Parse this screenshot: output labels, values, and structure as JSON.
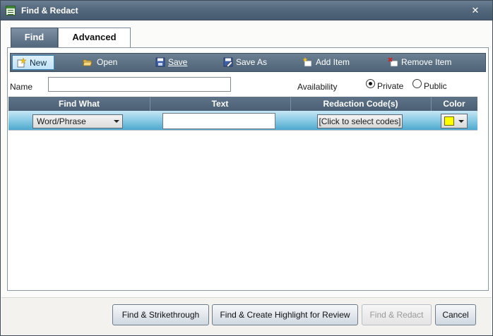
{
  "window": {
    "title": "Find & Redact",
    "close_glyph": "✕"
  },
  "tabs": [
    {
      "label": "Find",
      "active": false
    },
    {
      "label": "Advanced",
      "active": true
    }
  ],
  "toolbar": {
    "items": [
      {
        "label": "New",
        "icon": "new-document-icon"
      },
      {
        "label": "Open",
        "icon": "folder-open-icon"
      },
      {
        "label": "Save",
        "icon": "save-disk-icon"
      },
      {
        "label": "Save As",
        "icon": "save-as-icon"
      },
      {
        "label": "Add Item",
        "icon": "add-item-icon"
      },
      {
        "label": "Remove Item",
        "icon": "remove-item-icon"
      }
    ]
  },
  "form": {
    "name_label": "Name",
    "name_value": "",
    "availability_label": "Availability",
    "availability_options": [
      "Private",
      "Public"
    ],
    "availability_selected": "Private"
  },
  "grid": {
    "columns": [
      "Find What",
      "Text",
      "Redaction Code(s)",
      "Color"
    ],
    "rows": [
      {
        "find_what": "Word/Phrase",
        "text": "",
        "redaction_codes": "[Click to select codes]",
        "color": "#ffff00"
      }
    ]
  },
  "buttons": {
    "strikethrough": "Find & Strikethrough",
    "highlight": "Find & Create Highlight for Review",
    "redact": "Find & Redact",
    "cancel": "Cancel"
  },
  "colors": {
    "titlebar": "#54687d",
    "toolbar": "#5c7186",
    "row_highlight": "#8fcde6",
    "swatch": "#ffff00"
  }
}
